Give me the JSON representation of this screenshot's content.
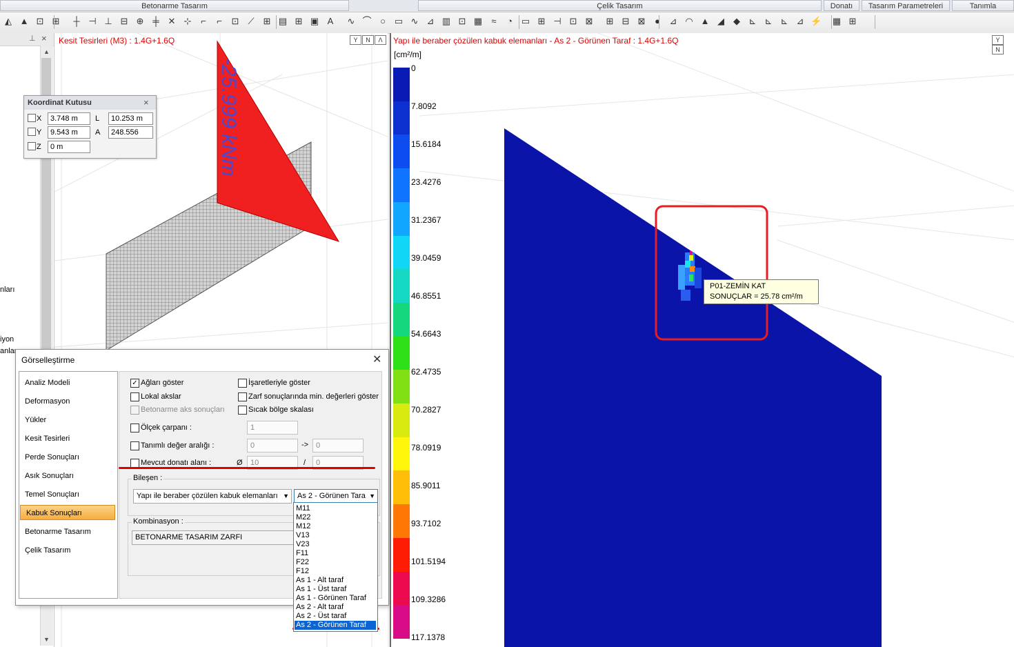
{
  "ribbon": {
    "tabs": [
      "Betonarme Tasarım",
      "Çelik Tasarım",
      "Donatı",
      "Tasarım Parametreleri",
      "Tanımla"
    ]
  },
  "left_view": {
    "title": "Kesit Tesirleri (M3) : 1.4G+1.6Q",
    "moment_label": "-25.999 kNm",
    "view_icons": [
      "Y",
      "N",
      "Λ"
    ]
  },
  "left_panel": {
    "partial_texts": [
      "nları",
      "iyon",
      "anları"
    ]
  },
  "coord_box": {
    "title": "Koordinat Kutusu",
    "x_label": "X",
    "x_value": "3.748 m",
    "y_label": "Y",
    "y_value": "9.543 m",
    "z_label": "Z",
    "z_value": "0 m",
    "l_label": "L",
    "l_value": "10.253 m",
    "a_label": "A",
    "a_value": "248.556"
  },
  "dialog": {
    "title": "Görselleştirme",
    "nav": [
      "Analiz Modeli",
      "Deformasyon",
      "Yükler",
      "Kesit Tesirleri",
      "Perde Sonuçları",
      "Asık Sonuçları",
      "Temel Sonuçları",
      "Kabuk Sonuçları",
      "Betonarme Tasarım",
      "Çelik Tasarım"
    ],
    "active_nav": "Kabuk Sonuçları",
    "options": {
      "show_mesh": "Ağları göster",
      "local_axes": "Lokal akslar",
      "rc_axis_results": "Betonarme aks sonuçları",
      "show_with_signs": "İşaretleriyle göster",
      "envelope_min": "Zarf sonuçlarında min. değerleri göster",
      "hot_zone_scale": "Sıcak bölge skalası",
      "scale_factor": "Ölçek çarpanı :",
      "defined_range": "Tanımlı değer aralığı :",
      "existing_rebar": "Mevcut donatı alanı :"
    },
    "scale_factor_value": "1",
    "range_from": "0",
    "range_arrow": "->",
    "range_to": "0",
    "rebar_symbol": "Ø",
    "rebar_diameter": "10",
    "rebar_sep": "/",
    "rebar_spacing": "0",
    "component_label": "Bileşen :",
    "component_element": "Yapı ile beraber çözülen kabuk elemanları",
    "component_value": "As 2 - Görünen Tara",
    "combination_label": "Kombinasyon :",
    "combination_value": "BETONARME TASARIM ZARFI",
    "dropdown_items": [
      "M11",
      "M22",
      "M12",
      "V13",
      "V23",
      "F11",
      "F22",
      "F12",
      "As 1 - Alt taraf",
      "As 1 - Üst taraf",
      "As 1 - Görünen Taraf",
      "As 2 - Alt taraf",
      "As 2 - Üst taraf",
      "As 2 - Görünen Taraf"
    ],
    "selected_item": "As 2 - Görünen Taraf"
  },
  "right_view": {
    "title": "Yapı ile beraber çözülen kabuk elemanları - As 2 - Görünen Taraf : 1.4G+1.6Q",
    "unit": "[cm²/m]",
    "scale_labels": [
      "0",
      "7.8092",
      "15.6184",
      "23.4276",
      "31.2367",
      "39.0459",
      "46.8551",
      "54.6643",
      "62.4735",
      "70.2827",
      "78.0919",
      "85.9011",
      "93.7102",
      "101.5194",
      "109.3286",
      "117.1378"
    ],
    "scale_colors": [
      "#0a1ab4",
      "#0c2fd0",
      "#0d4df0",
      "#0f74ff",
      "#11a6ff",
      "#12d6f6",
      "#14d8c4",
      "#15d87d",
      "#2ee018",
      "#80e014",
      "#d8ea10",
      "#fff60c",
      "#ffbe08",
      "#ff7806",
      "#ff1c04",
      "#ec0a4e",
      "#d80c86"
    ],
    "tooltip_line1": "P01-ZEMİN KAT",
    "tooltip_line2": "SONUÇLAR = 25.78 cm²/m",
    "view_icons": [
      "Y",
      "N"
    ],
    "plate_color": "#0a14a8"
  }
}
